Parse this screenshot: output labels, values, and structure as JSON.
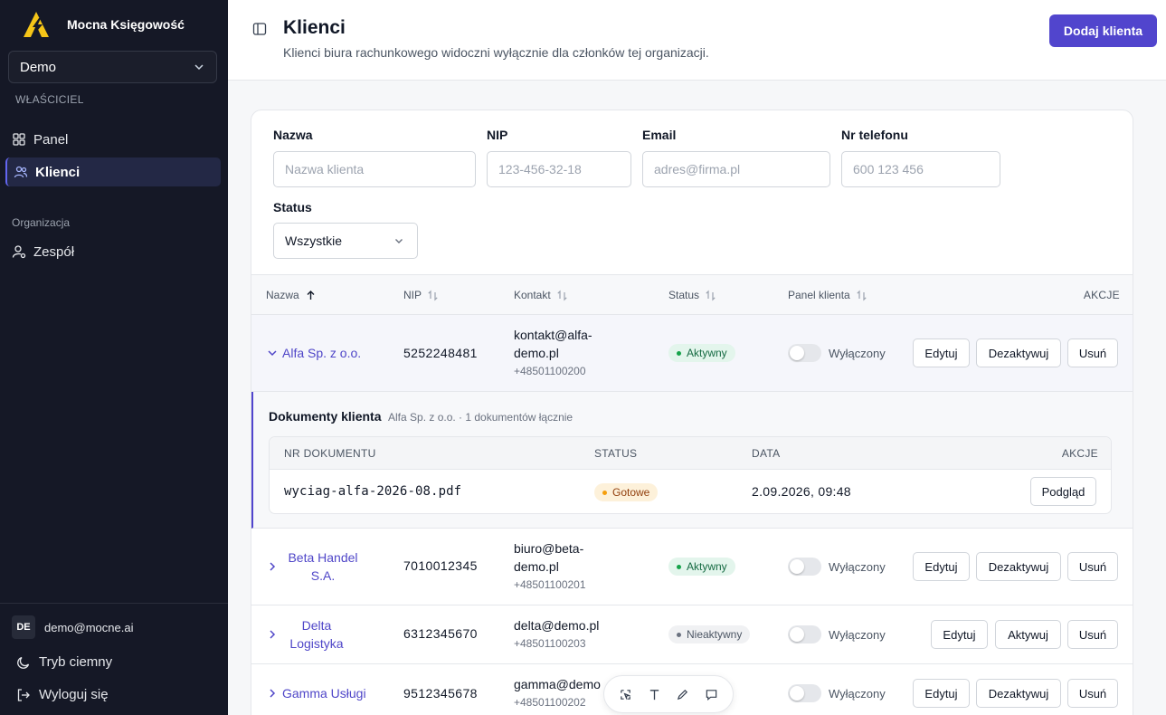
{
  "app": {
    "name": "Mocna Księgowość"
  },
  "sidebar": {
    "org_selected": "Demo",
    "role_label": "WŁAŚCICIEL",
    "items": [
      {
        "label": "Panel",
        "icon": "dashboard-icon"
      },
      {
        "label": "Klienci",
        "icon": "users-icon",
        "active": true
      }
    ],
    "section_label": "Organizacja",
    "org_items": [
      {
        "label": "Zespół",
        "icon": "team-icon"
      }
    ],
    "user": {
      "initials": "DE",
      "email": "demo@mocne.ai"
    },
    "footer": {
      "dark_mode": "Tryb ciemny",
      "logout": "Wyloguj się"
    }
  },
  "header": {
    "title": "Klienci",
    "subtitle": "Klienci biura rachunkowego widoczni wyłącznie dla członków tej organizacji.",
    "add_button": "Dodaj klienta"
  },
  "filters": {
    "name": {
      "label": "Nazwa",
      "placeholder": "Nazwa klienta"
    },
    "nip": {
      "label": "NIP",
      "placeholder": "123-456-32-18"
    },
    "email": {
      "label": "Email",
      "placeholder": "adres@firma.pl"
    },
    "phone": {
      "label": "Nr telefonu",
      "placeholder": "600 123 456"
    },
    "status": {
      "label": "Status",
      "value": "Wszystkie"
    }
  },
  "table": {
    "headers": {
      "name": "Nazwa",
      "nip": "NIP",
      "contact": "Kontakt",
      "status": "Status",
      "panel": "Panel klienta",
      "actions": "AKCJE"
    },
    "rows": [
      {
        "name": "Alfa Sp. z o.o.",
        "nip": "5252248481",
        "email_line1": "kontakt@alfa-",
        "email_line2": "demo.pl",
        "phone": "+48501100200",
        "status": "Aktywny",
        "panel": "Wyłączony",
        "edit": "Edytuj",
        "toggle": "Dezaktywuj",
        "delete": "Usuń"
      },
      {
        "name_line1": "Beta Handel",
        "name_line2": "S.A.",
        "nip": "7010012345",
        "email_line1": "biuro@beta-",
        "email_line2": "demo.pl",
        "phone": "+48501100201",
        "status": "Aktywny",
        "panel": "Wyłączony",
        "edit": "Edytuj",
        "toggle": "Dezaktywuj",
        "delete": "Usuń"
      },
      {
        "name_line1": "Delta",
        "name_line2": "Logistyka",
        "nip": "6312345670",
        "email": "delta@demo.pl",
        "phone": "+48501100203",
        "status": "Nieaktywny",
        "panel": "Wyłączony",
        "edit": "Edytuj",
        "toggle": "Aktywuj",
        "delete": "Usuń"
      },
      {
        "name": "Gamma Usługi",
        "nip": "9512345678",
        "email": "gamma@demo",
        "phone": "+48501100202",
        "panel": "Wyłączony",
        "edit": "Edytuj",
        "toggle": "Dezaktywuj",
        "delete": "Usuń"
      }
    ]
  },
  "documents": {
    "title": "Dokumenty klienta",
    "meta": "Alfa Sp. z o.o. · 1 dokumentów łącznie",
    "headers": {
      "number": "NR DOKUMENTU",
      "status": "STATUS",
      "date": "DATA",
      "actions": "AKCJE"
    },
    "rows": [
      {
        "name": "wyciag-alfa-2026-08.pdf",
        "status": "Gotowe",
        "date": "2.09.2026, 09:48",
        "action": "Podgląd"
      }
    ]
  },
  "colors": {
    "accent": "#5145cd",
    "sidebar_bg": "#151826",
    "active_green": "#16a34a",
    "ready_amber": "#f59e0b"
  }
}
